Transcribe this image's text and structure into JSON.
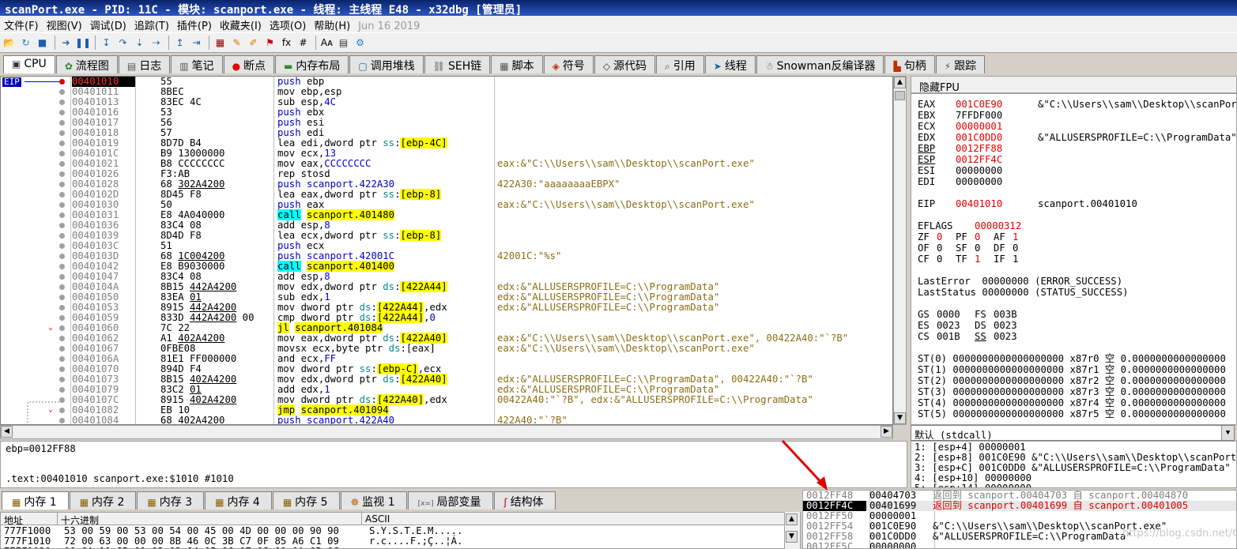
{
  "title": "scanPort.exe - PID: 11C - 模块: scanport.exe - 线程: 主线程 E48 - x32dbg [管理员]",
  "menu": [
    "文件(F)",
    "视图(V)",
    "调试(D)",
    "追踪(T)",
    "插件(P)",
    "收藏夹(I)",
    "选项(O)",
    "帮助(H)"
  ],
  "menu_date": "Jun 16 2019",
  "toolbar_icons": [
    "open-icon",
    "restart-icon",
    "stop-icon",
    "run-icon",
    "pause-icon",
    "step-into-icon",
    "step-over-icon",
    "trace-into-icon",
    "trace-over-icon",
    "execute-till-return-icon",
    "run-to-user-code-icon",
    "script-icon",
    "comment-icon",
    "label-icon",
    "bookmark-icon",
    "function-icon",
    "hash-icon",
    "font-icon",
    "calculator-icon",
    "settings-icon"
  ],
  "main_tabs": [
    {
      "icon": "cpu-icon",
      "label": "CPU",
      "active": true
    },
    {
      "icon": "flowchart-icon",
      "label": "流程图"
    },
    {
      "icon": "log-icon",
      "label": "日志"
    },
    {
      "icon": "notes-icon",
      "label": "笔记"
    },
    {
      "icon": "breakpoint-icon",
      "label": "断点"
    },
    {
      "icon": "memory-map-icon",
      "label": "内存布局"
    },
    {
      "icon": "callstack-icon",
      "label": "调用堆栈"
    },
    {
      "icon": "seh-icon",
      "label": "SEH链"
    },
    {
      "icon": "script-icon",
      "label": "脚本"
    },
    {
      "icon": "symbol-icon",
      "label": "符号"
    },
    {
      "icon": "source-icon",
      "label": "源代码"
    },
    {
      "icon": "reference-icon",
      "label": "引用"
    },
    {
      "icon": "thread-icon",
      "label": "线程"
    },
    {
      "icon": "snowman-icon",
      "label": "Snowman反编译器"
    },
    {
      "icon": "handle-icon",
      "label": "句柄"
    },
    {
      "icon": "trace-icon",
      "label": "跟踪"
    }
  ],
  "eip_label": "EIP",
  "disasm": [
    {
      "addr": "00401010",
      "bytes": "55",
      "ins": [
        [
          "push",
          "push"
        ],
        [
          "t",
          " ebp"
        ]
      ],
      "cmt": "",
      "eip": true,
      "bp": true
    },
    {
      "addr": "00401011",
      "bytes": "8BEC",
      "ins": [
        [
          "t",
          "mov ebp,esp"
        ]
      ],
      "cmt": ""
    },
    {
      "addr": "00401013",
      "bytes": "83EC 4C",
      "ins": [
        [
          "t",
          "sub "
        ],
        [
          "t",
          "esp"
        ],
        [
          "t",
          ","
        ],
        [
          "mem",
          "4C"
        ]
      ],
      "cmt": ""
    },
    {
      "addr": "00401016",
      "bytes": "53",
      "ins": [
        [
          "push",
          "push"
        ],
        [
          "t",
          " ebx"
        ]
      ],
      "cmt": ""
    },
    {
      "addr": "00401017",
      "bytes": "56",
      "ins": [
        [
          "push",
          "push"
        ],
        [
          "t",
          " esi"
        ]
      ],
      "cmt": ""
    },
    {
      "addr": "00401018",
      "bytes": "57",
      "ins": [
        [
          "push",
          "push"
        ],
        [
          "t",
          " edi"
        ]
      ],
      "cmt": ""
    },
    {
      "addr": "00401019",
      "bytes": "8D7D B4",
      "ins": [
        [
          "t",
          "lea edi,dword ptr "
        ],
        [
          "seg",
          "ss"
        ],
        [
          "t",
          ":"
        ],
        [
          "hl",
          "[ebp-4C]"
        ]
      ],
      "cmt": ""
    },
    {
      "addr": "0040101C",
      "bytes": "B9 13000000",
      "ins": [
        [
          "t",
          "mov ecx,"
        ],
        [
          "mem",
          "13"
        ]
      ],
      "cmt": ""
    },
    {
      "addr": "00401021",
      "bytes": "B8 CCCCCCCC",
      "ins": [
        [
          "t",
          "mov eax,"
        ],
        [
          "mem",
          "CCCCCCCC"
        ]
      ],
      "cmt": "eax:&\"C:\\\\Users\\\\sam\\\\Desktop\\\\scanPort.exe\""
    },
    {
      "addr": "00401026",
      "bytes": "F3:AB",
      "ins": [
        [
          "t",
          "rep stosd"
        ]
      ],
      "cmt": ""
    },
    {
      "addr": "00401028",
      "bytes": "68 302A4200",
      "ubytes": "302A4200",
      "ins": [
        [
          "push",
          "push"
        ],
        [
          "mem",
          " scanport.422A30"
        ]
      ],
      "cmt": "422A30:\"aaaaaaaaEBPX\""
    },
    {
      "addr": "0040102D",
      "bytes": "8D45 F8",
      "ins": [
        [
          "t",
          "lea eax,dword ptr "
        ],
        [
          "seg",
          "ss"
        ],
        [
          "t",
          ":"
        ],
        [
          "hl",
          "[ebp-8]"
        ]
      ],
      "cmt": ""
    },
    {
      "addr": "00401030",
      "bytes": "50",
      "ins": [
        [
          "push",
          "push"
        ],
        [
          "t",
          " eax"
        ]
      ],
      "cmt": "eax:&\"C:\\\\Users\\\\sam\\\\Desktop\\\\scanPort.exe\""
    },
    {
      "addr": "00401031",
      "bytes": "E8 4A040000",
      "ins": [
        [
          "call",
          "call"
        ],
        [
          "t",
          " "
        ],
        [
          "hl",
          "scanport.401480"
        ]
      ],
      "cmt": ""
    },
    {
      "addr": "00401036",
      "bytes": "83C4 08",
      "ins": [
        [
          "t",
          "add "
        ],
        [
          "t",
          "esp"
        ],
        [
          "t",
          ","
        ],
        [
          "mem",
          "8"
        ]
      ],
      "cmt": ""
    },
    {
      "addr": "00401039",
      "bytes": "8D4D F8",
      "ins": [
        [
          "t",
          "lea ecx,dword ptr "
        ],
        [
          "seg",
          "ss"
        ],
        [
          "t",
          ":"
        ],
        [
          "hl",
          "[ebp-8]"
        ]
      ],
      "cmt": ""
    },
    {
      "addr": "0040103C",
      "bytes": "51",
      "ins": [
        [
          "push",
          "push"
        ],
        [
          "t",
          " ecx"
        ]
      ],
      "cmt": ""
    },
    {
      "addr": "0040103D",
      "bytes": "68 1C004200",
      "ubytes": "1C004200",
      "ins": [
        [
          "push",
          "push"
        ],
        [
          "mem",
          " scanport.42001C"
        ]
      ],
      "cmt": "42001C:\"%s\""
    },
    {
      "addr": "00401042",
      "bytes": "E8 B9030000",
      "ins": [
        [
          "call",
          "call"
        ],
        [
          "t",
          " "
        ],
        [
          "hl",
          "scanport.401400"
        ]
      ],
      "cmt": ""
    },
    {
      "addr": "00401047",
      "bytes": "83C4 08",
      "ins": [
        [
          "t",
          "add "
        ],
        [
          "t",
          "esp"
        ],
        [
          "t",
          ","
        ],
        [
          "mem",
          "8"
        ]
      ],
      "cmt": ""
    },
    {
      "addr": "0040104A",
      "bytes": "8B15 442A4200",
      "ubytes": "442A4200",
      "ins": [
        [
          "t",
          "mov edx,dword ptr "
        ],
        [
          "seg",
          "ds"
        ],
        [
          "t",
          ":"
        ],
        [
          "hl",
          "[422A44]"
        ]
      ],
      "cmt": "edx:&\"ALLUSERSPROFILE=C:\\\\ProgramData\""
    },
    {
      "addr": "00401050",
      "bytes": "83EA 01",
      "ubytes": "01",
      "ins": [
        [
          "t",
          "sub edx,"
        ],
        [
          "mem",
          "1"
        ]
      ],
      "cmt": "edx:&\"ALLUSERSPROFILE=C:\\\\ProgramData\""
    },
    {
      "addr": "00401053",
      "bytes": "8915 442A4200",
      "ubytes": "442A4200",
      "ins": [
        [
          "t",
          "mov dword ptr "
        ],
        [
          "seg",
          "ds"
        ],
        [
          "t",
          ":"
        ],
        [
          "hl",
          "[422A44]"
        ],
        [
          "t",
          ",edx"
        ]
      ],
      "cmt": "edx:&\"ALLUSERSPROFILE=C:\\\\ProgramData\""
    },
    {
      "addr": "00401059",
      "bytes": "833D 442A4200 00",
      "ubytes": "442A4200",
      "ins": [
        [
          "t",
          "cmp dword ptr "
        ],
        [
          "seg",
          "ds"
        ],
        [
          "t",
          ":"
        ],
        [
          "hl",
          "[422A44]"
        ],
        [
          "t",
          ","
        ],
        [
          "mem",
          "0"
        ]
      ],
      "cmt": ""
    },
    {
      "addr": "00401060",
      "bytes": "7C 22",
      "ins": [
        [
          "jmp",
          "jl"
        ],
        [
          "t",
          " "
        ],
        [
          "hl",
          "scanport.401084"
        ]
      ],
      "cmt": "",
      "jump": true
    },
    {
      "addr": "00401062",
      "bytes": "A1 402A4200",
      "ubytes": "402A4200",
      "ins": [
        [
          "t",
          "mov eax,dword ptr "
        ],
        [
          "seg",
          "ds"
        ],
        [
          "t",
          ":"
        ],
        [
          "hl",
          "[422A40]"
        ]
      ],
      "cmt": "eax:&\"C:\\\\Users\\\\sam\\\\Desktop\\\\scanPort.exe\", 00422A40:\"`?B\""
    },
    {
      "addr": "00401067",
      "bytes": "0FBE08",
      "ins": [
        [
          "t",
          "movsx ecx,byte ptr "
        ],
        [
          "seg",
          "ds"
        ],
        [
          "t",
          ":"
        ],
        [
          "t",
          "[eax]"
        ]
      ],
      "cmt": "eax:&\"C:\\\\Users\\\\sam\\\\Desktop\\\\scanPort.exe\""
    },
    {
      "addr": "0040106A",
      "bytes": "81E1 FF000000",
      "ins": [
        [
          "t",
          "and ecx,"
        ],
        [
          "mem",
          "FF"
        ]
      ],
      "cmt": ""
    },
    {
      "addr": "00401070",
      "bytes": "894D F4",
      "ins": [
        [
          "t",
          "mov dword ptr "
        ],
        [
          "seg",
          "ss"
        ],
        [
          "t",
          ":"
        ],
        [
          "hl",
          "[ebp-C]"
        ],
        [
          "t",
          ",ecx"
        ]
      ],
      "cmt": ""
    },
    {
      "addr": "00401073",
      "bytes": "8B15 402A4200",
      "ubytes": "402A4200",
      "ins": [
        [
          "t",
          "mov edx,dword ptr "
        ],
        [
          "seg",
          "ds"
        ],
        [
          "t",
          ":"
        ],
        [
          "hl",
          "[422A40]"
        ]
      ],
      "cmt": "edx:&\"ALLUSERSPROFILE=C:\\\\ProgramData\", 00422A40:\"`?B\""
    },
    {
      "addr": "00401079",
      "bytes": "83C2 01",
      "ubytes": "01",
      "ins": [
        [
          "t",
          "add edx,"
        ],
        [
          "mem",
          "1"
        ]
      ],
      "cmt": "edx:&\"ALLUSERSPROFILE=C:\\\\ProgramData\""
    },
    {
      "addr": "0040107C",
      "bytes": "8915 402A4200",
      "ubytes": "402A4200",
      "ins": [
        [
          "t",
          "mov dword ptr "
        ],
        [
          "seg",
          "ds"
        ],
        [
          "t",
          ":"
        ],
        [
          "hl",
          "[422A40]"
        ],
        [
          "t",
          ",edx"
        ]
      ],
      "cmt": "00422A40:\"`?B\", edx:&\"ALLUSERSPROFILE=C:\\\\ProgramData\""
    },
    {
      "addr": "00401082",
      "bytes": "EB 10",
      "ins": [
        [
          "jmp",
          "jmp"
        ],
        [
          "t",
          " "
        ],
        [
          "hl",
          "scanport.401094"
        ]
      ],
      "cmt": "",
      "jump": true
    },
    {
      "addr": "00401084",
      "bytes": "68 402A4200",
      "ins": [
        [
          "push",
          "push"
        ],
        [
          "mem",
          " scanport.422A40"
        ]
      ],
      "cmt": "422A40:\"`?B\""
    }
  ],
  "fpu_header": "隐藏FPU",
  "registers": [
    {
      "name": "EAX",
      "value": "001C0E90",
      "red": true,
      "cmt": "&\"C:\\\\Users\\\\sam\\\\Desktop\\\\scanPort.exe\""
    },
    {
      "name": "EBX",
      "value": "7FFDF000",
      "red": false,
      "cmt": ""
    },
    {
      "name": "ECX",
      "value": "00000001",
      "red": true,
      "cmt": ""
    },
    {
      "name": "EDX",
      "value": "001C0DD0",
      "red": true,
      "cmt": "&\"ALLUSERSPROFILE=C:\\\\ProgramData\""
    },
    {
      "name": "EBP",
      "value": "0012FF88",
      "red": true,
      "cmt": "",
      "ul": true
    },
    {
      "name": "ESP",
      "value": "0012FF4C",
      "red": true,
      "cmt": "",
      "ul": true
    },
    {
      "name": "ESI",
      "value": "00000000",
      "red": false,
      "cmt": ""
    },
    {
      "name": "EDI",
      "value": "00000000",
      "red": false,
      "cmt": ""
    }
  ],
  "eip_reg": {
    "name": "EIP",
    "value": "00401010",
    "cmt": "scanport.00401010"
  },
  "eflags": {
    "name": "EFLAGS",
    "value": "00000312"
  },
  "flags": [
    [
      [
        "ZF",
        "0",
        true
      ],
      [
        "PF",
        "0",
        true
      ],
      [
        "AF",
        "1",
        true
      ]
    ],
    [
      [
        "OF",
        "0",
        false
      ],
      [
        "SF",
        "0",
        false
      ],
      [
        "DF",
        "0",
        false
      ]
    ],
    [
      [
        "CF",
        "0",
        false
      ],
      [
        "TF",
        "1",
        true
      ],
      [
        "IF",
        "1",
        false
      ]
    ]
  ],
  "last_error": "LastError  00000000 (ERROR_SUCCESS)",
  "last_status": "LastStatus 00000000 (STATUS_SUCCESS)",
  "segments": [
    [
      [
        "GS",
        "0000",
        false
      ],
      [
        "FS",
        "003B",
        false
      ]
    ],
    [
      [
        "ES",
        "0023",
        false
      ],
      [
        "DS",
        "0023",
        false
      ]
    ],
    [
      [
        "CS",
        "001B",
        false
      ],
      [
        "SS",
        "0023",
        true
      ]
    ]
  ],
  "fpu": [
    "ST(0) 0000000000000000000 x87r0 空 0.0000000000000000",
    "ST(1) 0000000000000000000 x87r1 空 0.0000000000000000",
    "ST(2) 0000000000000000000 x87r2 空 0.0000000000000000",
    "ST(3) 0000000000000000000 x87r3 空 0.0000000000000000",
    "ST(4) 0000000000000000000 x87r4 空 0.0000000000000000",
    "ST(5) 0000000000000000000 x87r5 空 0.0000000000000000"
  ],
  "callconv": "默认 (stdcall)",
  "args": [
    "1: [esp+4] 00000001",
    "2: [esp+8] 001C0E90 &\"C:\\\\Users\\\\sam\\\\Desktop\\\\scanPort.exe\"",
    "3: [esp+C] 001C0DD0 &\"ALLUSERSPROFILE=C:\\\\ProgramData\"",
    "4: [esp+10] 00000000",
    "5: [esp+14] 00000000"
  ],
  "info": {
    "line1": "ebp=0012FF88",
    "line2": ".text:00401010 scanport.exe:$1010 #1010"
  },
  "dump_tabs": [
    {
      "icon": "memory-icon",
      "label": "内存 1",
      "active": true
    },
    {
      "icon": "memory-icon",
      "label": "内存 2"
    },
    {
      "icon": "memory-icon",
      "label": "内存 3"
    },
    {
      "icon": "memory-icon",
      "label": "内存 4"
    },
    {
      "icon": "memory-icon",
      "label": "内存 5"
    },
    {
      "icon": "watch-icon",
      "label": "监视 1"
    },
    {
      "icon": "locals-icon",
      "label": "局部变量"
    },
    {
      "icon": "struct-icon",
      "label": "结构体"
    }
  ],
  "dump_headers": {
    "addr": "地址",
    "hex": "十六进制",
    "ascii": "ASCII"
  },
  "dump_rows": [
    {
      "addr": "777F1000",
      "hex": "53 00 59 00 53 00 54 00 45 00 4D 00 00 00 90 90",
      "ascii": "S.Y.S.T.E.M....."
    },
    {
      "addr": "777F1010",
      "hex": "72 00 63 00 00 00 8B 46 0C 3B C7 0F 85 A6 C1 09",
      "ascii": "r.c....F.;Ç..¦Á."
    },
    {
      "addr": "777F1020",
      "hex": "00 8A 11 8B 01 02 03 04 05 06 07 08 09 0A 0B 0C",
      "ascii": "..............."
    }
  ],
  "stack": [
    {
      "addr": "0012FF48",
      "val": "00404703",
      "cmt": "返回到 scanport.00404703 自 scanport.00404870",
      "style": "grey"
    },
    {
      "addr": "0012FF4C",
      "val": "00401699",
      "cmt": "返回到 scanport.00401699 自 scanport.00401005",
      "style": "red",
      "sel": true
    },
    {
      "addr": "0012FF50",
      "val": "00000001",
      "cmt": "",
      "style": ""
    },
    {
      "addr": "0012FF54",
      "val": "001C0E90",
      "cmt": "&\"C:\\\\Users\\\\sam\\\\Desktop\\\\scanPort.exe\"",
      "style": ""
    },
    {
      "addr": "0012FF58",
      "val": "001C0DD0",
      "cmt": "&\"ALLUSERSPROFILE=C:\\\\ProgramData\"",
      "style": ""
    },
    {
      "addr": "0012FF5C",
      "val": "00000000",
      "cmt": "",
      "style": ""
    }
  ],
  "watermark": "https://blog.csdn.net/Cody_Ren"
}
